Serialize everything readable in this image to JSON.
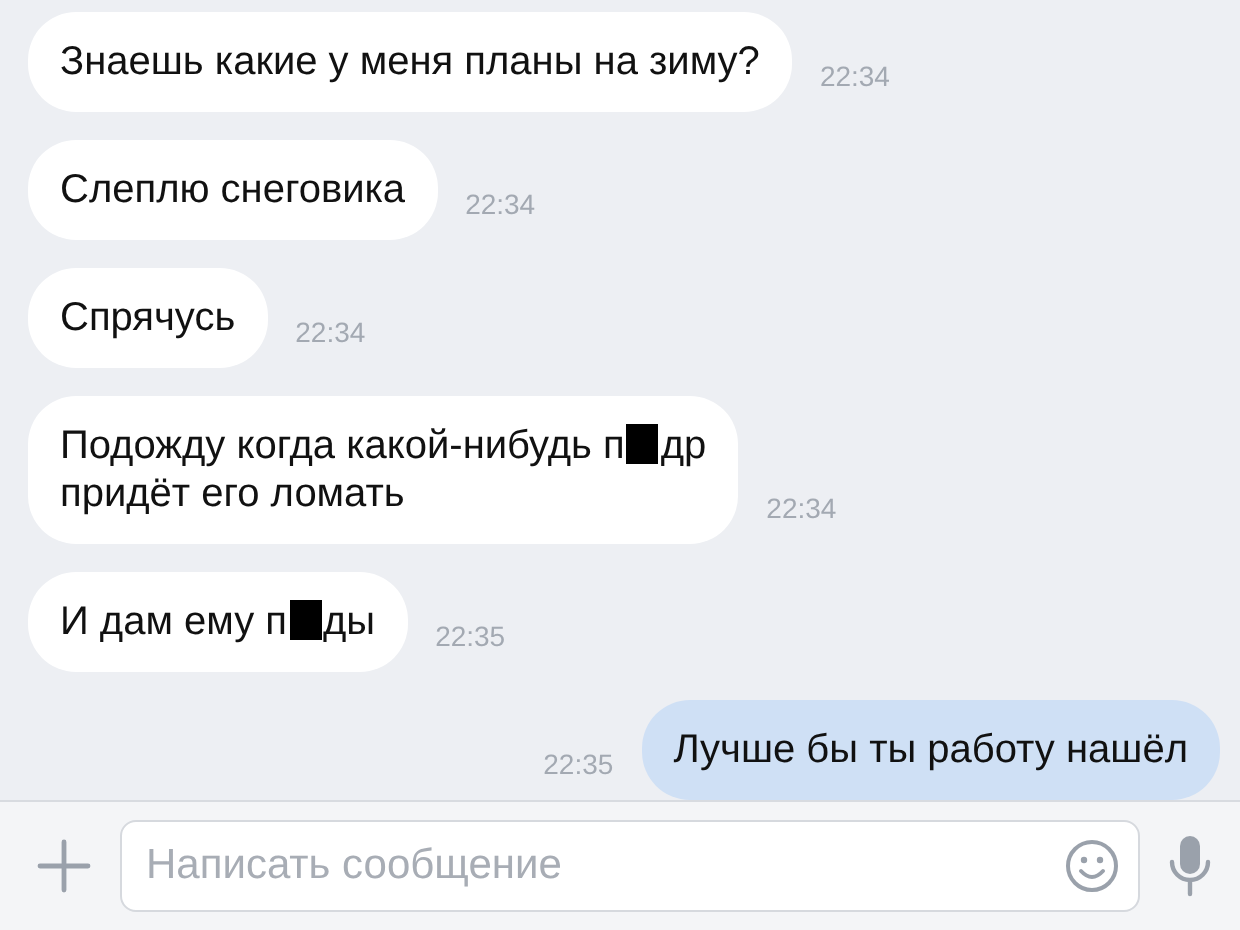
{
  "messages": [
    {
      "kind": "incoming",
      "time": "22:34",
      "segments": [
        {
          "kind": "text",
          "text": "Знаешь какие у меня планы на зиму?"
        }
      ]
    },
    {
      "kind": "incoming",
      "time": "22:34",
      "segments": [
        {
          "kind": "text",
          "text": "Слеплю снеговика"
        }
      ]
    },
    {
      "kind": "incoming",
      "time": "22:34",
      "segments": [
        {
          "kind": "text",
          "text": "Спрячусь"
        }
      ]
    },
    {
      "kind": "incoming",
      "time": "22:34",
      "segments": [
        {
          "kind": "text",
          "text": "Подожду когда какой-нибудь п"
        },
        {
          "kind": "censor"
        },
        {
          "kind": "text",
          "text": "др"
        },
        {
          "kind": "break"
        },
        {
          "kind": "text",
          "text": "придёт его ломать"
        }
      ]
    },
    {
      "kind": "incoming",
      "time": "22:35",
      "segments": [
        {
          "kind": "text",
          "text": "И дам ему п"
        },
        {
          "kind": "censor"
        },
        {
          "kind": "text",
          "text": "ды"
        }
      ]
    },
    {
      "kind": "outgoing",
      "time": "22:35",
      "segments": [
        {
          "kind": "text",
          "text": "Лучше бы ты работу нашёл"
        }
      ]
    }
  ],
  "composer": {
    "placeholder": "Написать сообщение"
  }
}
